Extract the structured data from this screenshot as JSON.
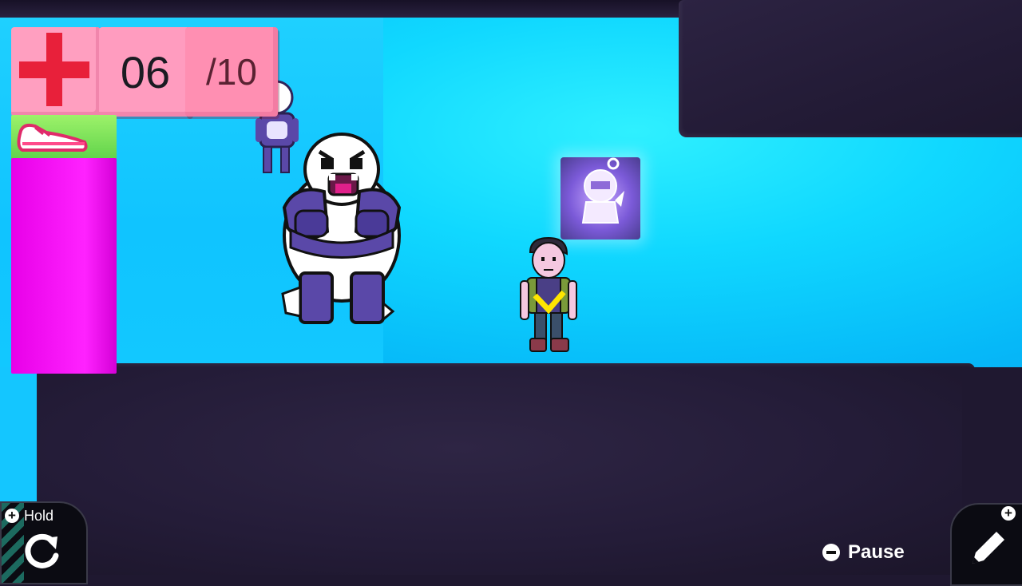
{
  "hud": {
    "health_current": "06",
    "health_max": "/10",
    "health_icon": "red-cross-icon",
    "speed_icon": "sneaker-icon"
  },
  "controls": {
    "hold_label": "Hold",
    "hold_icon": "rotate-icon",
    "pause_label": "Pause",
    "edit_icon": "pencil-icon"
  },
  "colors": {
    "health_bg": "#ff9cbf",
    "cross": "#e8203a",
    "speed_bg": "#7ee05a",
    "bar": "#f00cf0",
    "sky": "#10d0ff",
    "wall": "#241c38",
    "marker": "#ffe600"
  }
}
